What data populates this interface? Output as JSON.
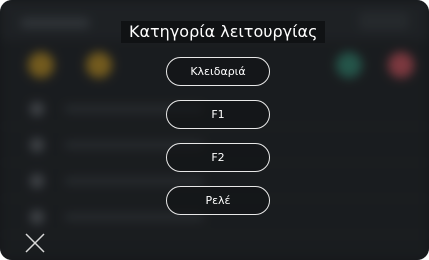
{
  "dialog": {
    "title": "Κατηγορία λειτουργίας",
    "options": [
      "Κλειδαριά",
      "F1",
      "F2",
      "Ρελέ"
    ]
  },
  "icons": {
    "close": "close-icon"
  },
  "colors": {
    "overlay_text": "#ffffff",
    "button_border": "#e8e8e8",
    "background": "#1c1f22",
    "accent_amber": "#c89a2a",
    "accent_teal": "#3a8f79",
    "accent_red": "#d85c66"
  }
}
